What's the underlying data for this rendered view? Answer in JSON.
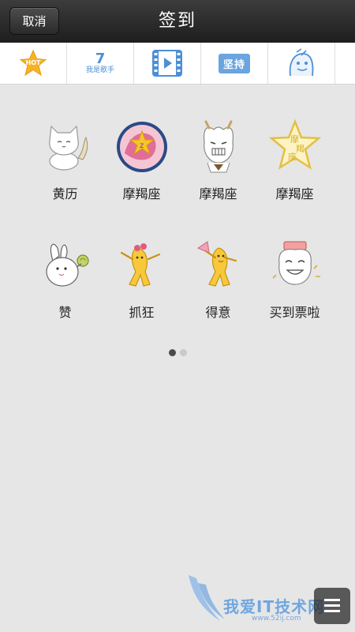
{
  "header": {
    "cancel_label": "取消",
    "title": "签到"
  },
  "tabs": [
    {
      "name": "hot",
      "icon": "hot-star-icon",
      "label": "HOT"
    },
    {
      "name": "ad",
      "icon": "seven-logo-icon",
      "label": "我是歌手"
    },
    {
      "name": "video",
      "icon": "film-icon",
      "label": ""
    },
    {
      "name": "jianchi",
      "icon": "jianchi-badge-icon",
      "label": "坚持"
    },
    {
      "name": "doodle",
      "icon": "doodle-face-icon",
      "label": ""
    }
  ],
  "grid": {
    "rows": [
      [
        {
          "label": "黄历",
          "icon": "white-cat-meditating-icon"
        },
        {
          "label": "摩羯座",
          "icon": "capricorn-circle-icon"
        },
        {
          "label": "摩羯座",
          "icon": "horned-cat-icon"
        },
        {
          "label": "摩羯座",
          "icon": "capricorn-gold-star-icon"
        }
      ],
      [
        {
          "label": "赞",
          "icon": "rabbit-thumbs-up-icon"
        },
        {
          "label": "抓狂",
          "icon": "banana-dancer-icon"
        },
        {
          "label": "得意",
          "icon": "banana-fan-icon"
        },
        {
          "label": "买到票啦",
          "icon": "cat-ticket-icon"
        }
      ]
    ]
  },
  "pager": {
    "total": 2,
    "current": 1
  },
  "watermark": {
    "text": "我爱IT技术网",
    "url": "www.52ij.com"
  },
  "colors": {
    "accent": "#4c8fd6",
    "bar": "#2b2b2b",
    "bg": "#e6e6e6"
  }
}
